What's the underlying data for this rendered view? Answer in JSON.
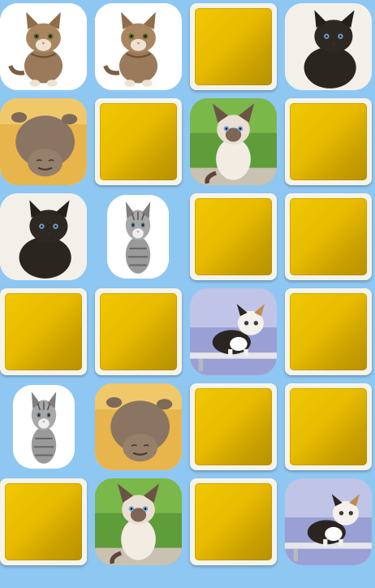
{
  "game": {
    "rows": 6,
    "cols": 4,
    "tiles": [
      {
        "state": "face-up",
        "image": "tabby-kitten-sitting"
      },
      {
        "state": "face-up",
        "image": "tabby-kitten-sitting"
      },
      {
        "state": "face-down",
        "image": "card-back"
      },
      {
        "state": "face-up",
        "image": "black-kitten"
      },
      {
        "state": "face-up",
        "image": "sleeping-kitten-on-back"
      },
      {
        "state": "face-down",
        "image": "card-back"
      },
      {
        "state": "face-up",
        "image": "siamese-kitten-grass"
      },
      {
        "state": "face-down",
        "image": "card-back"
      },
      {
        "state": "face-up",
        "image": "black-kitten"
      },
      {
        "state": "face-up",
        "image": "grey-striped-kitten"
      },
      {
        "state": "face-down",
        "image": "card-back"
      },
      {
        "state": "face-down",
        "image": "card-back"
      },
      {
        "state": "face-down",
        "image": "card-back"
      },
      {
        "state": "face-down",
        "image": "card-back"
      },
      {
        "state": "face-up",
        "image": "calico-kitten-on-bench"
      },
      {
        "state": "face-down",
        "image": "card-back"
      },
      {
        "state": "face-up",
        "image": "grey-striped-kitten"
      },
      {
        "state": "face-up",
        "image": "sleeping-kitten-on-back"
      },
      {
        "state": "face-down",
        "image": "card-back"
      },
      {
        "state": "face-down",
        "image": "card-back"
      },
      {
        "state": "face-down",
        "image": "card-back"
      },
      {
        "state": "face-up",
        "image": "siamese-kitten-grass"
      },
      {
        "state": "face-down",
        "image": "card-back"
      },
      {
        "state": "face-up",
        "image": "calico-kitten-on-bench"
      }
    ],
    "colors": {
      "background": "#8ec7f2",
      "card_back_gold": "#e8bb00",
      "card_border": "#f6f4ea"
    }
  }
}
